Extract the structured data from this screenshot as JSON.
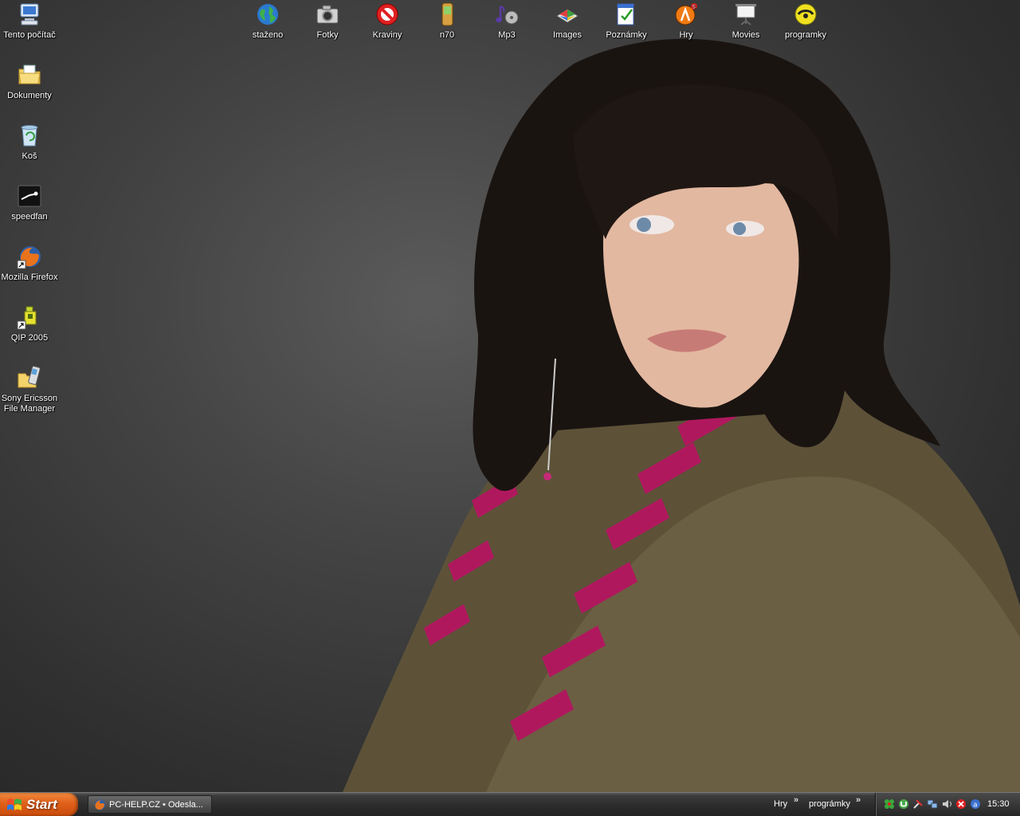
{
  "desktop": {
    "left_icons": [
      {
        "label": "Tento počítač",
        "icon": "my-computer-icon"
      },
      {
        "label": "Dokumenty",
        "icon": "documents-folder-icon"
      },
      {
        "label": "Koš",
        "icon": "recycle-bin-icon"
      },
      {
        "label": "speedfan",
        "icon": "speedfan-icon"
      },
      {
        "label": "Mozilla Firefox",
        "icon": "firefox-icon"
      },
      {
        "label": "QIP 2005",
        "icon": "qip-icon"
      },
      {
        "label": "Sony Ericsson\nFile Manager",
        "icon": "phone-folder-icon"
      }
    ],
    "top_icons": [
      {
        "label": "staženo",
        "icon": "globe-icon"
      },
      {
        "label": "Fotky",
        "icon": "camera-icon"
      },
      {
        "label": "Kraviny",
        "icon": "no-sign-icon"
      },
      {
        "label": "n70",
        "icon": "mobile-phone-icon"
      },
      {
        "label": "Mp3",
        "icon": "music-note-icon"
      },
      {
        "label": "Images",
        "icon": "images-icon"
      },
      {
        "label": "Poznámky",
        "icon": "notes-icon"
      },
      {
        "label": "Hry",
        "icon": "half-life-icon"
      },
      {
        "label": "Movies",
        "icon": "projector-screen-icon"
      },
      {
        "label": "programky",
        "icon": "programs-icon"
      }
    ]
  },
  "taskbar": {
    "start_label": "Start",
    "task_title": "PC-HELP.CZ • Odesla...",
    "toolbar_1": "Hry",
    "toolbar_2": "prográmky",
    "chevron": "»",
    "clock": "15:30"
  },
  "colors": {
    "start_orange": "#e0601a",
    "taskbar_dark": "#2d2d2d"
  }
}
